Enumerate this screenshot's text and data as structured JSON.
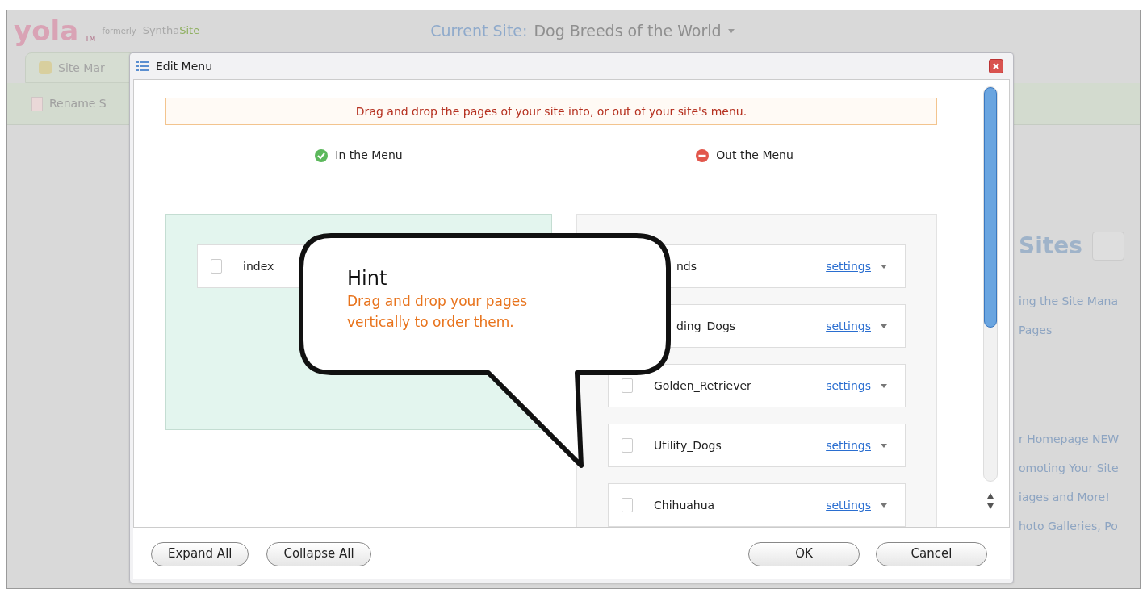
{
  "background_page": {
    "logo": "yola",
    "logo_mark": "TM",
    "formerly": "formerly",
    "brand": "Syntha",
    "brand_suffix": "Site",
    "current_site_label": "Current Site:",
    "current_site_name": "Dog Breeds of the World",
    "tab": "Site Mar",
    "toolbar_item": "Rename S",
    "sites_heading": "Sites",
    "links": [
      "ing the Site Mana",
      "Pages",
      "r Homepage NEW",
      "omoting Your Site",
      "iages and More!",
      "hoto Galleries, Po"
    ]
  },
  "dialog": {
    "title": "Edit Menu",
    "notice": "Drag and drop the pages of your site into, or out of your site's menu.",
    "in_menu": {
      "heading": "In the Menu",
      "pages": [
        {
          "name": "index",
          "covered": false
        }
      ]
    },
    "out_menu": {
      "heading": "Out the Menu",
      "pages": [
        {
          "name": "nds",
          "link": "settings",
          "covered": true
        },
        {
          "name": "ding_Dogs",
          "link": "settings",
          "covered": true
        },
        {
          "name": "Golden_Retriever",
          "link": "settings",
          "covered": false
        },
        {
          "name": "Utility_Dogs",
          "link": "settings",
          "covered": false
        },
        {
          "name": "Chihuahua",
          "link": "settings",
          "covered": false
        }
      ]
    },
    "left_buttons": [
      "Expand All",
      "Collapse All"
    ],
    "right_buttons": [
      "OK",
      "Cancel"
    ]
  },
  "hint": {
    "title": "Hint",
    "text": "Drag and drop your pages vertically to order them."
  }
}
